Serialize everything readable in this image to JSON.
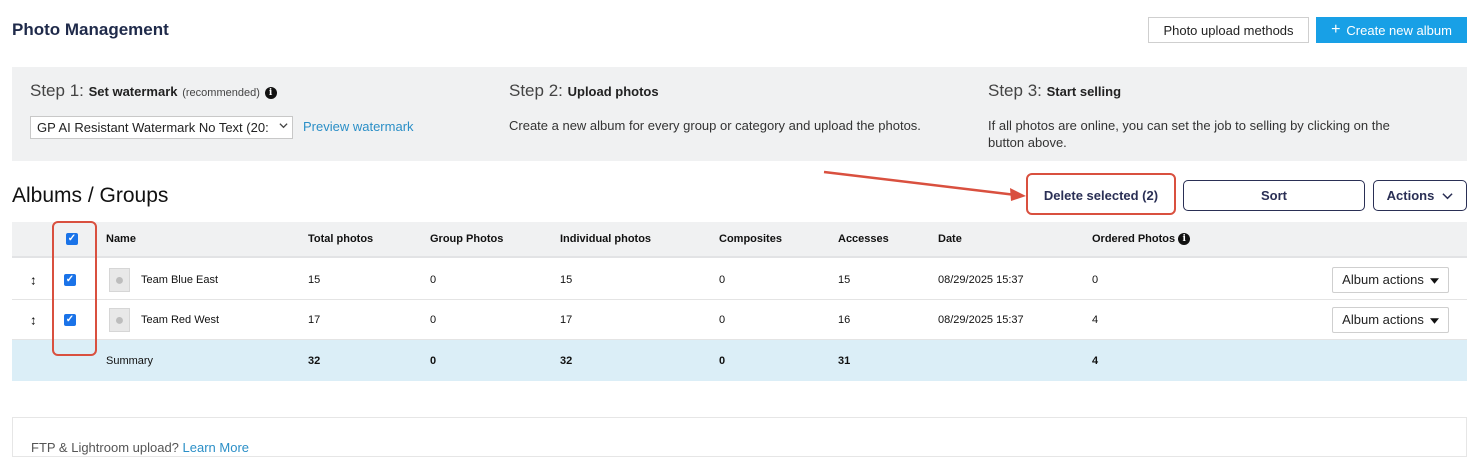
{
  "header": {
    "title": "Photo Management",
    "upload_methods_label": "Photo upload methods",
    "create_album_label": "Create new album",
    "create_album_plus": "+"
  },
  "steps": {
    "step1": {
      "prefix": "Step 1:",
      "title": "Set watermark",
      "note": "(recommended)",
      "info_glyph": "i",
      "watermark_value": "GP AI Resistant Watermark No Text (20:",
      "preview_link": "Preview watermark"
    },
    "step2": {
      "prefix": "Step 2:",
      "title": "Upload photos",
      "description": "Create a new album for every group or category and upload the photos."
    },
    "step3": {
      "prefix": "Step 3:",
      "title": "Start selling",
      "description_line1": "If all photos are online, you can set the job to selling by clicking on the",
      "description_line2": "button above."
    }
  },
  "albums": {
    "section_title": "Albums / Groups",
    "delete_selected_label": "Delete selected (2)",
    "sort_label": "Sort",
    "actions_label": "Actions",
    "columns": {
      "name": "Name",
      "total_photos": "Total photos",
      "group_photos": "Group Photos",
      "individual_photos": "Individual photos",
      "composites": "Composites",
      "accesses": "Accesses",
      "date": "Date",
      "ordered_photos": "Ordered Photos"
    },
    "rows": [
      {
        "name": "Team Blue East",
        "total_photos": "15",
        "group_photos": "0",
        "individual_photos": "15",
        "composites": "0",
        "accesses": "15",
        "date": "08/29/2025 15:37",
        "ordered_photos": "0",
        "action_label": "Album actions"
      },
      {
        "name": "Team Red West",
        "total_photos": "17",
        "group_photos": "0",
        "individual_photos": "17",
        "composites": "0",
        "accesses": "16",
        "date": "08/29/2025 15:37",
        "ordered_photos": "4",
        "action_label": "Album actions"
      }
    ],
    "summary": {
      "label": "Summary",
      "total_photos": "32",
      "group_photos": "0",
      "individual_photos": "32",
      "composites": "0",
      "accesses": "31",
      "ordered_photos": "4"
    }
  },
  "footer": {
    "ftp_text": "FTP & Lightroom upload?",
    "ftp_link": "Learn More"
  },
  "colors": {
    "accent": "#18a0e6",
    "highlight": "#d9503f",
    "checkbox": "#1a73e8",
    "summary_bg": "#dbeef7",
    "link": "#2b8fc7"
  }
}
